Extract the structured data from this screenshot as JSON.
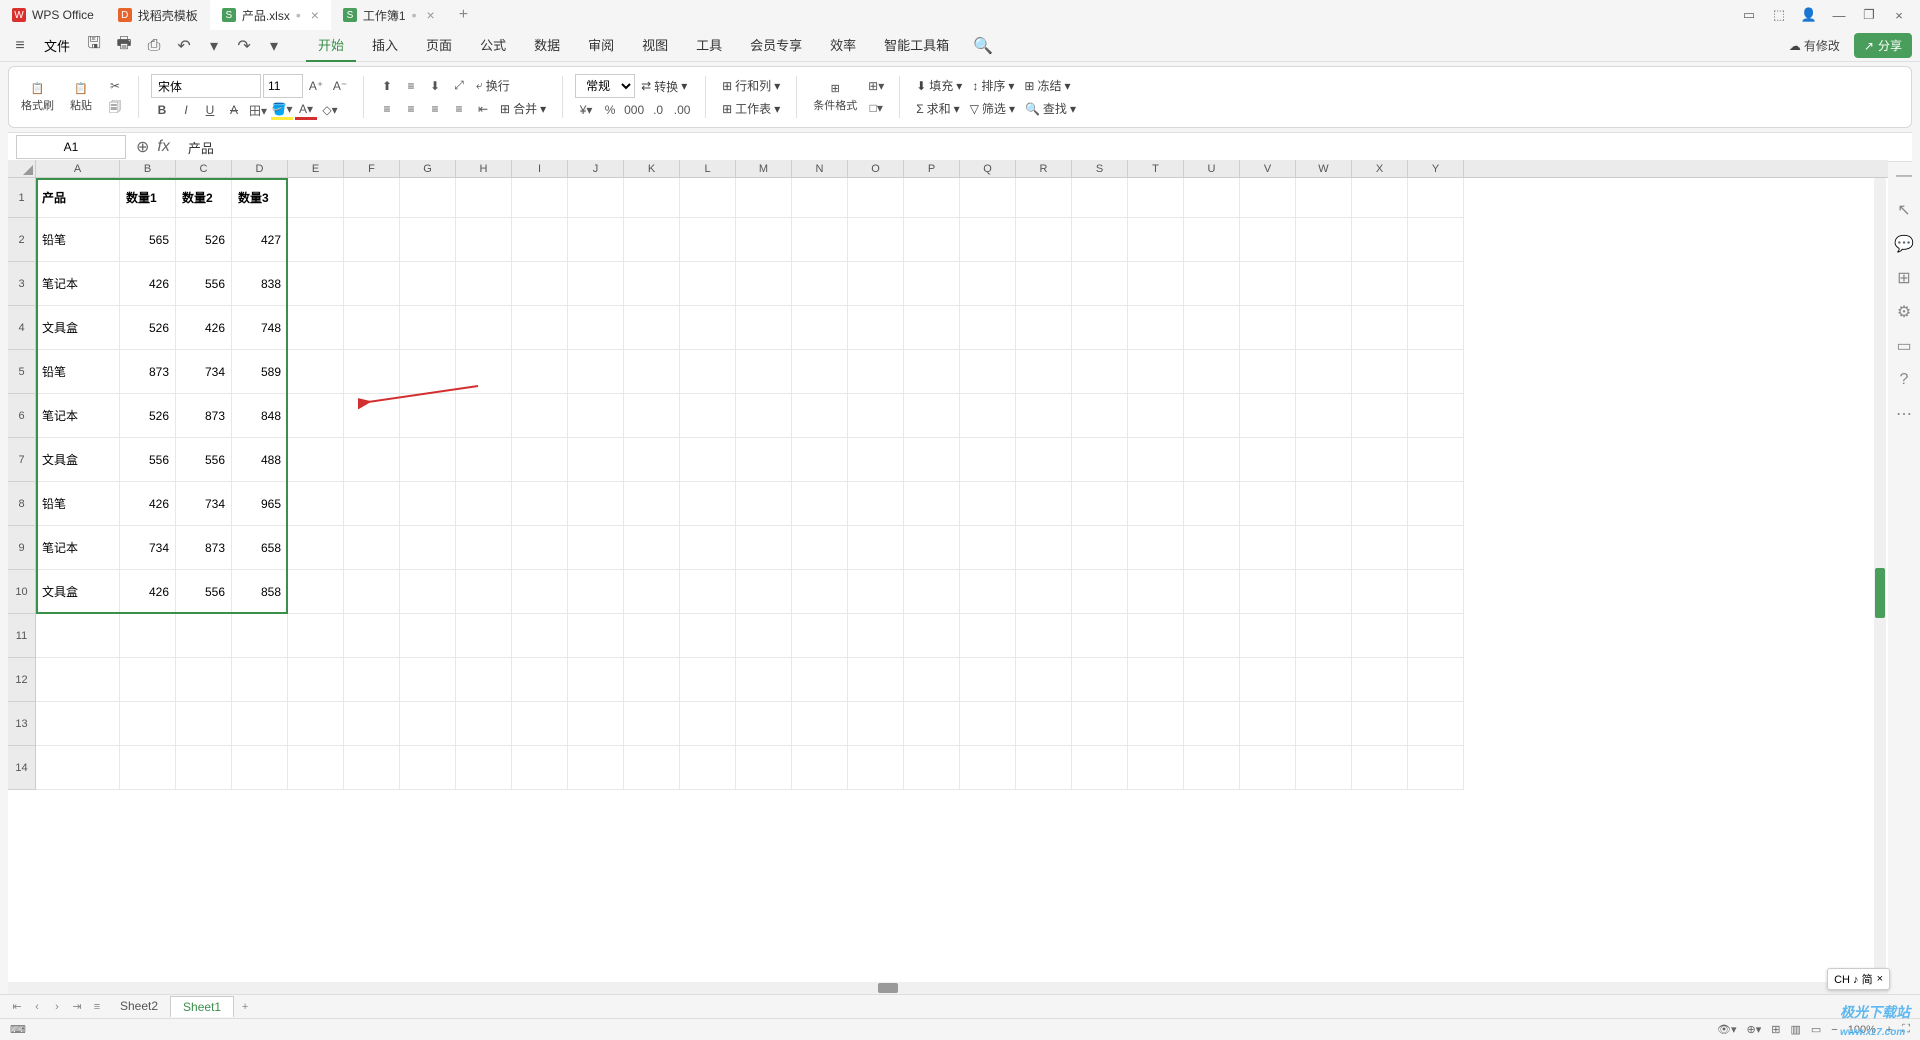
{
  "tabs": [
    {
      "icon": "W",
      "label": "WPS Office"
    },
    {
      "icon": "D",
      "label": "找稻壳模板"
    },
    {
      "icon": "S",
      "label": "产品.xlsx",
      "active": true,
      "modified": true
    },
    {
      "icon": "S",
      "label": "工作簿1",
      "modified": true
    }
  ],
  "menu": {
    "file": "文件",
    "tabs": [
      "开始",
      "插入",
      "页面",
      "公式",
      "数据",
      "审阅",
      "视图",
      "工具",
      "会员专享",
      "效率",
      "智能工具箱"
    ],
    "active_tab": "开始",
    "modified_label": "有修改",
    "share": "分享"
  },
  "ribbon": {
    "format_painter": "格式刷",
    "paste": "粘贴",
    "font": "宋体",
    "size": "11",
    "wrap": "换行",
    "merge": "合并",
    "number_format": "常规",
    "convert": "转换",
    "rows_cols": "行和列",
    "worksheet": "工作表",
    "cond_format": "条件格式",
    "fill": "填充",
    "sort": "排序",
    "freeze": "冻结",
    "sum": "求和",
    "filter": "筛选",
    "find": "查找"
  },
  "formula_bar": {
    "cell_ref": "A1",
    "formula": "产品"
  },
  "columns": [
    "A",
    "B",
    "C",
    "D",
    "E",
    "F",
    "G",
    "H",
    "I",
    "J",
    "K",
    "L",
    "M",
    "N",
    "O",
    "P",
    "Q",
    "R",
    "S",
    "T",
    "U",
    "V",
    "W",
    "X",
    "Y"
  ],
  "col_widths": {
    "A": 84,
    "default": 56
  },
  "row_heights": {
    "1": 40,
    "data": 44,
    "empty": 44
  },
  "chart_data": {
    "type": "table",
    "headers": [
      "产品",
      "数量1",
      "数量2",
      "数量3"
    ],
    "rows": [
      [
        "铅笔",
        565,
        526,
        427
      ],
      [
        "笔记本",
        426,
        556,
        838
      ],
      [
        "文具盒",
        526,
        426,
        748
      ],
      [
        "铅笔",
        873,
        734,
        589
      ],
      [
        "笔记本",
        526,
        873,
        848
      ],
      [
        "文具盒",
        556,
        556,
        488
      ],
      [
        "铅笔",
        426,
        734,
        965
      ],
      [
        "笔记本",
        734,
        873,
        658
      ],
      [
        "文具盒",
        426,
        556,
        858
      ]
    ]
  },
  "selection": {
    "from": "A1",
    "to": "D10"
  },
  "sheets": [
    "Sheet2",
    "Sheet1"
  ],
  "active_sheet": "Sheet1",
  "status": {
    "zoom": "100%",
    "ime": "CH ♪ 简"
  },
  "watermark": "极光下载站 www.xz7.com"
}
